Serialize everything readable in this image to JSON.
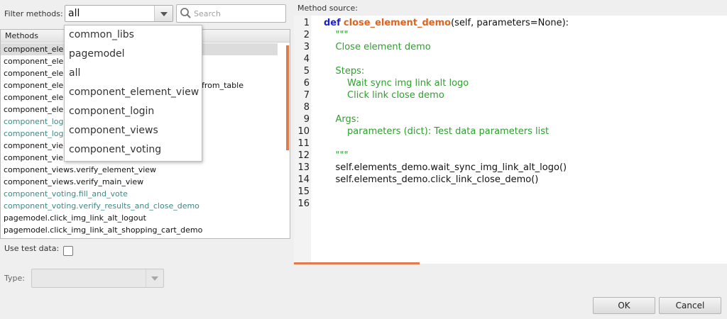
{
  "filter": {
    "label": "Filter methods:",
    "value": "all",
    "search_placeholder": "Search",
    "options": [
      "common_libs",
      "pagemodel",
      "all",
      "component_element_view",
      "component_login",
      "component_views",
      "component_voting"
    ]
  },
  "methods": {
    "header": "Methods",
    "rows": [
      {
        "text": "component_ele",
        "tail": ""
      },
      {
        "text": "component_ele",
        "tail": ""
      },
      {
        "text": "component_ele",
        "tail": ""
      },
      {
        "text": "component_ele",
        "tail": "from_table"
      },
      {
        "text": "component_ele",
        "tail": ""
      },
      {
        "text": "component_ele",
        "tail": ""
      },
      {
        "text": "component_log",
        "tail": ""
      },
      {
        "text": "component_log",
        "tail": ""
      },
      {
        "text": "component_vie",
        "tail": ""
      },
      {
        "text": "component_vie",
        "tail": ""
      },
      {
        "text": "component_views.verify_element_view",
        "tail": ""
      },
      {
        "text": "component_views.verify_main_view",
        "tail": ""
      },
      {
        "text": "component_voting.fill_and_vote",
        "tail": ""
      },
      {
        "text": "component_voting.verify_results_and_close_demo",
        "tail": ""
      },
      {
        "text": "pagemodel.click_img_link_alt_logout",
        "tail": ""
      },
      {
        "text": "pagemodel.click_img_link_alt_shopping_cart_demo",
        "tail": ""
      }
    ]
  },
  "use_test_data": {
    "label": "Use test data:",
    "checked": false
  },
  "type": {
    "label": "Type:",
    "value": ""
  },
  "source": {
    "label": "Method source:",
    "line_numbers": [
      "1",
      "2",
      "3",
      "4",
      "5",
      "6",
      "7",
      "8",
      "9",
      "10",
      "11",
      "12",
      "13",
      "14",
      "15",
      "16"
    ],
    "kw_def": "def",
    "func_name": "close_element_demo",
    "signature": "(self, parameters=None):",
    "lines": [
      "    \"\"\"",
      "    Close element demo",
      "",
      "    Steps:",
      "        Wait sync img link alt logo",
      "        Click link close demo",
      "",
      "    Args:",
      "        parameters (dict): Test data parameters list",
      "",
      "    \"\"\"",
      "    self.elements_demo.wait_sync_img_link_alt_logo()",
      "    self.elements_demo.click_link_close_demo()",
      "",
      ""
    ]
  },
  "buttons": {
    "ok": "OK",
    "cancel": "Cancel"
  },
  "colors": {
    "accent": "#e07c4b",
    "keyword": "#1f1fc8",
    "function": "#e06320",
    "docstring": "#2da02d",
    "green_item": "#3d8a84"
  }
}
